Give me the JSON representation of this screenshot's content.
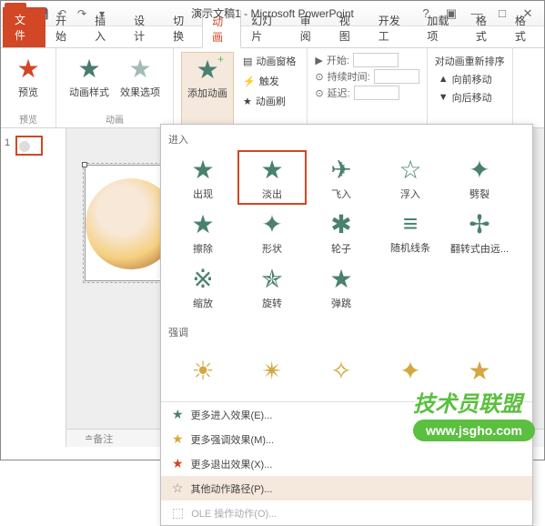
{
  "window": {
    "title": "演示文稿1 - Microsoft PowerPoint",
    "app_letter": "P"
  },
  "tabs": {
    "file": "文件",
    "items": [
      "开始",
      "插入",
      "设计",
      "切换",
      "动画",
      "幻灯片",
      "审阅",
      "视图",
      "开发工",
      "加载项",
      "格式",
      "格式"
    ],
    "active_index": 4
  },
  "ribbon": {
    "preview": {
      "label": "预览",
      "group": "预览"
    },
    "anim_style": "动画样式",
    "effect_opts": "效果选项",
    "anim_group": "动画",
    "add_anim": "添加动画",
    "anim_pane": "动画窗格",
    "trigger": "触发",
    "anim_painter": "动画刷",
    "start_label": "开始:",
    "duration_label": "持续时间:",
    "delay_label": "延迟:",
    "reorder": "对动画重新排序",
    "move_earlier": "向前移动",
    "move_later": "向后移动"
  },
  "gallery": {
    "entrance_title": "进入",
    "entrance": [
      {
        "label": "出现",
        "icon": "★"
      },
      {
        "label": "淡出",
        "icon": "★",
        "highlighted": true
      },
      {
        "label": "飞入",
        "icon": "✈"
      },
      {
        "label": "浮入",
        "icon": "☆"
      },
      {
        "label": "劈裂",
        "icon": "✦"
      },
      {
        "label": "擦除",
        "icon": "★"
      },
      {
        "label": "形状",
        "icon": "✦"
      },
      {
        "label": "轮子",
        "icon": "✱"
      },
      {
        "label": "随机线条",
        "icon": "≡"
      },
      {
        "label": "翻转式由远...",
        "icon": "✢"
      },
      {
        "label": "缩放",
        "icon": "※"
      },
      {
        "label": "旋转",
        "icon": "✯"
      },
      {
        "label": "弹跳",
        "icon": "★"
      }
    ],
    "emphasis_title": "强调",
    "emphasis": [
      {
        "icon": "☀"
      },
      {
        "icon": "✴"
      },
      {
        "icon": "✧"
      },
      {
        "icon": "✦"
      },
      {
        "icon": "★"
      }
    ],
    "more_entrance": "更多进入效果(E)...",
    "more_emphasis": "更多强调效果(M)...",
    "more_exit": "更多退出效果(X)...",
    "more_motion": "其他动作路径(P)...",
    "ole_action": "OLE 操作动作(O)..."
  },
  "slide": {
    "number": "1"
  },
  "notes": {
    "label": "备注"
  },
  "watermark": {
    "text": "技术员联盟",
    "url": "www.jsgho.com"
  }
}
